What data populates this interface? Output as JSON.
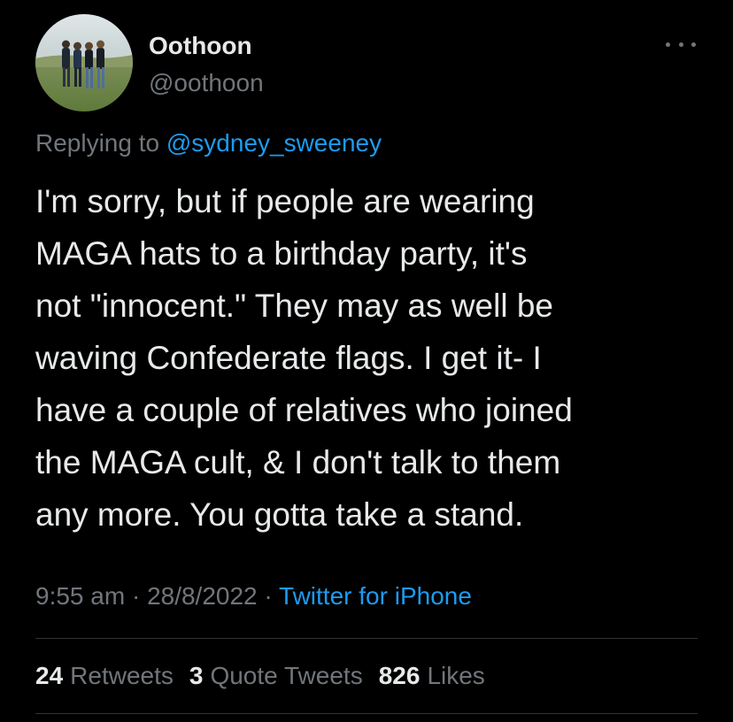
{
  "user": {
    "display_name": "Oothoon",
    "handle": "@oothoon"
  },
  "icons": {
    "more": "more-horizontal-icon",
    "avatar": "profile-photo"
  },
  "reply": {
    "prefix": "Replying to",
    "target": "@sydney_sweeney"
  },
  "tweet": {
    "lines": [
      "I'm sorry, but if people are wearing",
      "MAGA hats to a birthday party, it's",
      "not \"innocent.\" They may as well be",
      "waving Confederate flags. I get it- I",
      "have a couple of relatives who joined",
      "the MAGA cult, & I don't talk to them",
      "any more. You gotta take a stand."
    ]
  },
  "meta": {
    "time": "9:55 am",
    "date": "28/8/2022",
    "separator": "·",
    "source": "Twitter for iPhone"
  },
  "stats": {
    "retweets": {
      "count": "24",
      "label": "Retweets"
    },
    "quotes": {
      "count": "3",
      "label": "Quote Tweets"
    },
    "likes": {
      "count": "826",
      "label": "Likes"
    }
  },
  "colors": {
    "background": "#000000",
    "text": "#e7e9ea",
    "muted": "#71767b",
    "accent": "#1d9bf0",
    "divider": "#2f3336"
  }
}
